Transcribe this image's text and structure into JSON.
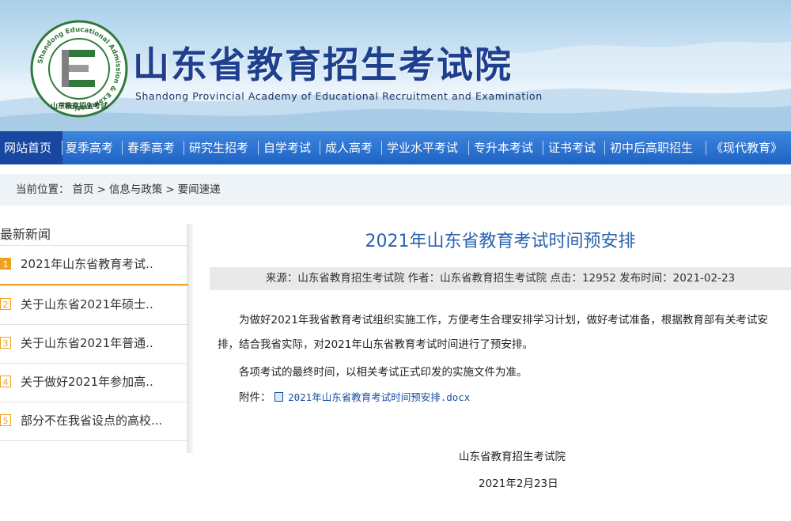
{
  "header": {
    "title": "山东省教育招生考试院",
    "subtitle": "Shandong Provincial Academy of Educational Recruitment and Examination",
    "logo_ring_text": "Shandong Educational Admission & Examinations",
    "logo_bottom_text": "山东教育招生考试"
  },
  "nav": {
    "items": [
      {
        "label": "网站首页",
        "active": true
      },
      {
        "label": "夏季高考"
      },
      {
        "label": "春季高考"
      },
      {
        "label": "研究生招考"
      },
      {
        "label": "自学考试"
      },
      {
        "label": "成人高考"
      },
      {
        "label": "学业水平考试"
      },
      {
        "label": "专升本考试"
      },
      {
        "label": "证书考试"
      },
      {
        "label": "初中后高职招生"
      },
      {
        "label": "《现代教育》"
      }
    ]
  },
  "breadcrumb": {
    "prefix": "当前位置：",
    "items": [
      "首页",
      "信息与政策",
      "要闻速递"
    ],
    "separator": ">"
  },
  "sidebar": {
    "title": "最新新闻",
    "items": [
      {
        "num": "1",
        "label": "2021年山东省教育考试.."
      },
      {
        "num": "2",
        "label": "关于山东省2021年硕士.."
      },
      {
        "num": "3",
        "label": "关于山东省2021年普通.."
      },
      {
        "num": "4",
        "label": "关于做好2021年参加高.."
      },
      {
        "num": "5",
        "label": "部分不在我省设点的高校..."
      }
    ]
  },
  "article": {
    "title": "2021年山东省教育考试时间预安排",
    "meta": "来源：山东省教育招生考试院 作者：山东省教育招生考试院 点击：12952 发布时间：2021-02-23",
    "paragraph1": "为做好2021年我省教育考试组织实施工作，方便考生合理安排学习计划，做好考试准备，根据教育部有关考试安排，结合我省实际，对2021年山东省教育考试时间进行了预安排。",
    "paragraph2": "各项考试的最终时间，以相关考试正式印发的实施文件为准。",
    "attachment_label": "附件：",
    "attachment_file": "2021年山东省教育考试时间预安排.docx",
    "signature": "山东省教育招生考试院",
    "date": "2021年2月23日"
  },
  "colors": {
    "nav_bg": "#2a6fd0",
    "nav_active": "#1747a0",
    "title_blue": "#2a62b0",
    "accent_orange": "#f0a020",
    "logo_green": "#2f7a3a"
  }
}
